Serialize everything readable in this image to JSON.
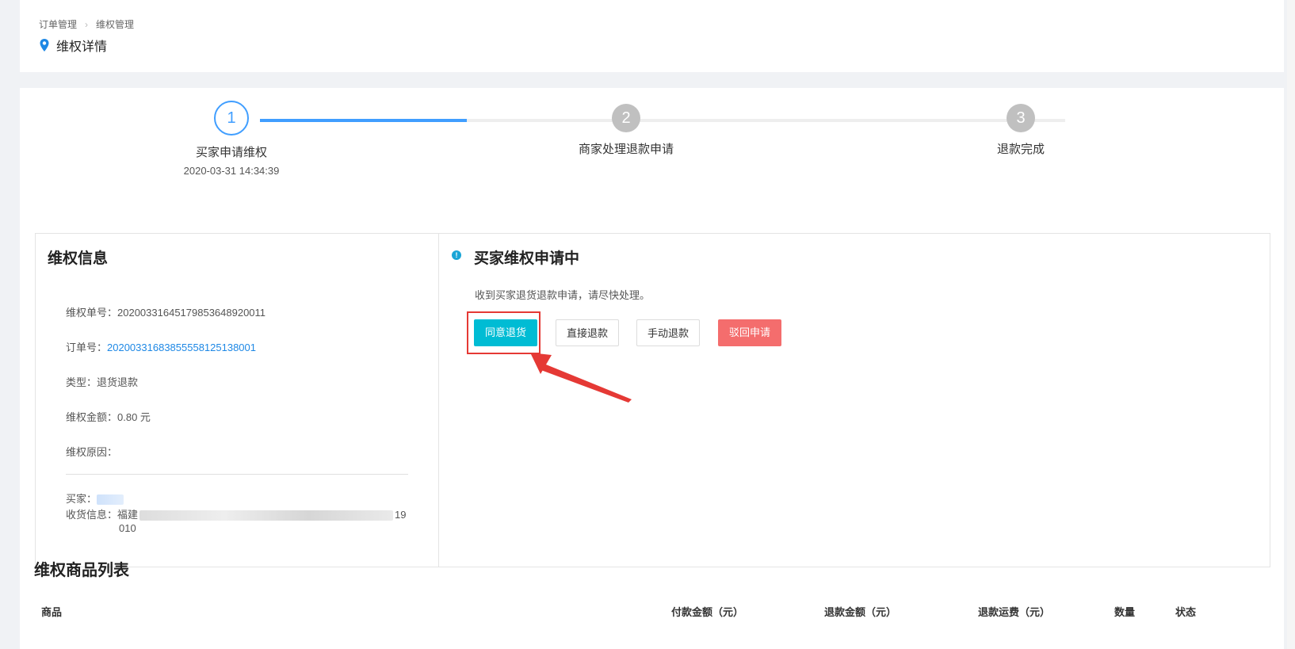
{
  "breadcrumb": {
    "items": [
      "订单管理",
      "维权管理"
    ],
    "separator": "›"
  },
  "page": {
    "title": "维权详情"
  },
  "steps": [
    {
      "number": "1",
      "title": "买家申请维权",
      "time": "2020-03-31 14:34:39",
      "state": "active"
    },
    {
      "number": "2",
      "title": "商家处理退款申请",
      "time": "",
      "state": "pending"
    },
    {
      "number": "3",
      "title": "退款完成",
      "time": "",
      "state": "pending"
    }
  ],
  "progress": {
    "completed_fraction": 0.17
  },
  "rights_info": {
    "title": "维权信息",
    "rights_no_label": "维权单号：",
    "rights_no": "20200331645179853648920011",
    "order_no_label": "订单号：",
    "order_no": "20200331683855558125138001",
    "type_label": "类型：",
    "type": "退货退款",
    "amount_label": "维权金额：",
    "amount": "0.80 元",
    "reason_label": "维权原因：",
    "reason": "",
    "buyer_label": "买家：",
    "address_label": "收货信息：",
    "address_visible_start": "福建",
    "address_visible_end": "19",
    "address_line2": "010"
  },
  "status_panel": {
    "title": "买家维权申请中",
    "hint": "收到买家退货退款申请，请尽快处理。",
    "buttons": {
      "agree": "同意退货",
      "direct_refund": "直接退款",
      "manual_refund": "手动退款",
      "reject": "驳回申请"
    }
  },
  "product_list": {
    "title": "维权商品列表",
    "columns": [
      "商品",
      "付款金额（元）",
      "退款金额（元）",
      "退款运费（元）",
      "数量",
      "状态"
    ]
  },
  "colors": {
    "accent": "#409eff",
    "agree_button": "#00bcd4",
    "reject_button": "#f46d6d",
    "link": "#1e88e5",
    "annotation": "#e53935"
  },
  "icons": [
    "location-pin-icon",
    "info-icon"
  ]
}
